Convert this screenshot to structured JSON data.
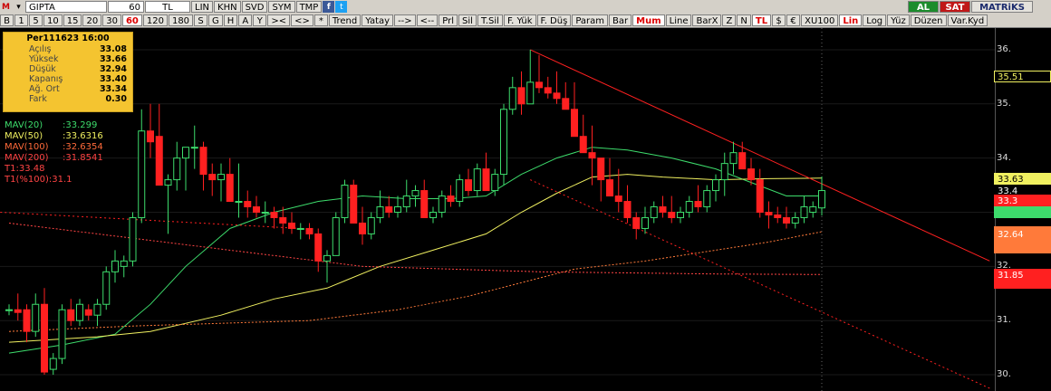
{
  "toolbar": {
    "symbol": "GIPTA",
    "interval_value": "60",
    "currency": "TL",
    "row1_buttons": [
      "LIN",
      "KHN",
      "SVD",
      "SYM",
      "TMP"
    ],
    "right_buttons": {
      "al": "AL",
      "sat": "SAT",
      "brand": "MATRiKS"
    },
    "row2_left": [
      "B",
      "1",
      "5",
      "10",
      "15",
      "20",
      "30",
      "60",
      "120",
      "180",
      "S",
      "G",
      "H",
      "A",
      "Y"
    ],
    "row2_selected": "60",
    "row2_mid": [
      "><",
      "<>",
      "*",
      "Trend",
      "Yatay",
      "-->",
      "<--",
      "Prl",
      "Sil",
      "T.Sil",
      "F. Yük",
      "F. Düş",
      "Param"
    ],
    "row2_type": [
      "Bar",
      "Mum",
      "Line",
      "BarX"
    ],
    "row2_type_selected": "Mum",
    "row2_right": [
      "Z",
      "N",
      "TL",
      "$",
      "€",
      "XU100",
      "Lin",
      "Log",
      "Yüz",
      "Düzen",
      "Var.Kyd"
    ],
    "row2_right_selected": [
      "TL",
      "Lin"
    ]
  },
  "info_box": {
    "header": "Per111623 16:00",
    "rows": [
      {
        "label": "Açılış",
        "value": "33.08"
      },
      {
        "label": "Yüksek",
        "value": "33.66"
      },
      {
        "label": "Düşük",
        "value": "32.94"
      },
      {
        "label": "Kapanış",
        "value": "33.40"
      },
      {
        "label": "Ağ. Ort",
        "value": "33.34"
      },
      {
        "label": "Fark",
        "value": "0.30"
      }
    ]
  },
  "legend": [
    {
      "name": "MAV(20)",
      "value": ":33.299",
      "color": "#3ddc6c"
    },
    {
      "name": "MAV(50)",
      "value": ":33.6316",
      "color": "#f0f060"
    },
    {
      "name": "MAV(100)",
      "value": ":32.6354",
      "color": "#ff6a3a"
    },
    {
      "name": "MAV(200)",
      "value": ":31.8541",
      "color": "#ff4444"
    },
    {
      "name": "T1:33.48",
      "value": "",
      "color": "#ff4444"
    },
    {
      "name": "T1(%100):31.1",
      "value": "",
      "color": "#ff4444"
    }
  ],
  "price_tags": [
    {
      "value": "35.51",
      "bg": "#000000",
      "fg": "#f0f060",
      "border": "#f0f060"
    },
    {
      "value": "33.63",
      "bg": "#f0f060",
      "fg": "#000000",
      "border": "#f0f060"
    },
    {
      "value": "33.4",
      "bg": "#000000",
      "fg": "#ffffff",
      "border": "#000000"
    },
    {
      "value": "33.3",
      "bg": "#ff2020",
      "fg": "#ffffff",
      "border": "#ff2020"
    },
    {
      "value": "",
      "bg": "#3ddc6c",
      "fg": "#000000",
      "border": "#3ddc6c"
    },
    {
      "value": "32.64",
      "bg": "#ff7a3a",
      "fg": "#ffffff",
      "border": "#ff7a3a"
    },
    {
      "value": "31.85",
      "bg": "#ff2020",
      "fg": "#ffffff",
      "border": "#ff2020"
    }
  ],
  "chart_data": {
    "type": "candlestick",
    "y_ticks": [
      "30.",
      "31.",
      "32.",
      "33.",
      "34.",
      "35.",
      "36."
    ],
    "ylim": [
      29.7,
      36.4
    ],
    "up_color": "#3ddc6c",
    "down_color": "#ff2020",
    "candles": [
      [
        31.2,
        31.3,
        31.1,
        31.2
      ],
      [
        31.2,
        31.5,
        31.0,
        31.15
      ],
      [
        31.2,
        31.3,
        30.6,
        30.8
      ],
      [
        30.8,
        31.5,
        30.7,
        31.3
      ],
      [
        31.3,
        31.6,
        30.0,
        30.05
      ],
      [
        30.1,
        30.4,
        30.0,
        30.3
      ],
      [
        30.3,
        31.3,
        30.2,
        31.2
      ],
      [
        31.2,
        31.4,
        30.9,
        31.0
      ],
      [
        31.0,
        31.4,
        30.9,
        31.3
      ],
      [
        31.2,
        31.3,
        31.0,
        31.1
      ],
      [
        31.1,
        31.4,
        30.9,
        31.3
      ],
      [
        31.3,
        32.0,
        31.2,
        31.9
      ],
      [
        31.9,
        32.3,
        31.7,
        32.1
      ],
      [
        32.0,
        32.2,
        31.8,
        32.1
      ],
      [
        32.1,
        33.0,
        32.0,
        32.9
      ],
      [
        32.9,
        34.9,
        32.8,
        34.5
      ],
      [
        34.5,
        35.0,
        34.0,
        34.3
      ],
      [
        34.4,
        35.0,
        33.5,
        33.5
      ],
      [
        33.5,
        33.7,
        32.6,
        33.6
      ],
      [
        33.6,
        34.3,
        33.4,
        34.0
      ],
      [
        34.0,
        34.2,
        33.4,
        34.2
      ],
      [
        34.2,
        34.6,
        33.8,
        34.2
      ],
      [
        34.2,
        34.3,
        33.4,
        33.7
      ],
      [
        33.7,
        33.9,
        33.3,
        33.6
      ],
      [
        33.6,
        33.9,
        33.2,
        33.7
      ],
      [
        33.7,
        34.0,
        33.4,
        33.2
      ],
      [
        33.2,
        33.9,
        32.9,
        33.2
      ],
      [
        33.2,
        33.4,
        32.9,
        33.1
      ],
      [
        33.1,
        33.3,
        32.9,
        33.0
      ],
      [
        33.0,
        33.2,
        32.8,
        33.0
      ],
      [
        33.0,
        33.1,
        32.7,
        32.9
      ],
      [
        32.9,
        33.1,
        32.6,
        32.8
      ],
      [
        32.8,
        33.0,
        32.6,
        32.7
      ],
      [
        32.7,
        32.8,
        32.5,
        32.7
      ],
      [
        32.7,
        32.8,
        32.5,
        32.6
      ],
      [
        32.6,
        32.7,
        31.9,
        32.1
      ],
      [
        32.1,
        32.3,
        31.7,
        32.2
      ],
      [
        32.2,
        33.0,
        32.2,
        32.9
      ],
      [
        32.9,
        33.6,
        32.8,
        33.5
      ],
      [
        33.5,
        33.6,
        32.8,
        32.8
      ],
      [
        32.8,
        33.1,
        32.4,
        32.6
      ],
      [
        32.6,
        33.0,
        32.5,
        32.9
      ],
      [
        32.9,
        33.4,
        32.8,
        33.1
      ],
      [
        33.1,
        33.3,
        32.9,
        33.0
      ],
      [
        33.0,
        33.3,
        32.9,
        33.1
      ],
      [
        33.1,
        33.6,
        33.0,
        33.3
      ],
      [
        33.3,
        33.5,
        33.1,
        33.4
      ],
      [
        33.4,
        33.6,
        33.0,
        32.9
      ],
      [
        32.9,
        33.1,
        32.8,
        33.0
      ],
      [
        33.0,
        33.4,
        32.9,
        33.3
      ],
      [
        33.3,
        33.5,
        33.1,
        33.2
      ],
      [
        33.2,
        33.7,
        33.1,
        33.6
      ],
      [
        33.6,
        33.8,
        33.3,
        33.4
      ],
      [
        33.4,
        33.9,
        33.3,
        33.8
      ],
      [
        33.8,
        34.1,
        33.5,
        33.4
      ],
      [
        33.4,
        33.8,
        33.3,
        33.7
      ],
      [
        33.7,
        35.0,
        33.5,
        34.9
      ],
      [
        34.9,
        35.5,
        34.8,
        35.3
      ],
      [
        35.3,
        35.6,
        34.8,
        35.0
      ],
      [
        35.0,
        36.0,
        35.0,
        35.4
      ],
      [
        35.4,
        35.9,
        35.2,
        35.3
      ],
      [
        35.3,
        35.5,
        35.1,
        35.2
      ],
      [
        35.2,
        35.6,
        35.0,
        35.1
      ],
      [
        35.1,
        35.4,
        34.9,
        34.9
      ],
      [
        34.9,
        35.4,
        34.4,
        34.4
      ],
      [
        34.4,
        34.8,
        34.1,
        34.1
      ],
      [
        34.1,
        34.6,
        33.5,
        34.0
      ],
      [
        34.0,
        34.0,
        33.2,
        33.6
      ],
      [
        33.6,
        34.0,
        33.4,
        33.3
      ],
      [
        33.3,
        33.8,
        33.0,
        33.2
      ],
      [
        33.2,
        33.5,
        32.8,
        32.9
      ],
      [
        32.9,
        33.0,
        32.5,
        32.7
      ],
      [
        32.7,
        33.1,
        32.6,
        32.9
      ],
      [
        32.9,
        33.2,
        32.8,
        33.1
      ],
      [
        33.1,
        33.3,
        32.9,
        33.0
      ],
      [
        33.0,
        33.3,
        32.8,
        32.9
      ],
      [
        32.9,
        33.1,
        32.8,
        33.0
      ],
      [
        33.0,
        33.3,
        32.9,
        33.2
      ],
      [
        33.2,
        33.5,
        33.0,
        33.1
      ],
      [
        33.1,
        33.5,
        33.0,
        33.4
      ],
      [
        33.4,
        33.7,
        33.2,
        33.6
      ],
      [
        33.6,
        34.1,
        33.3,
        33.9
      ],
      [
        33.9,
        34.3,
        33.7,
        34.1
      ],
      [
        34.1,
        34.3,
        33.8,
        33.8
      ],
      [
        33.8,
        34.0,
        33.5,
        33.6
      ],
      [
        33.6,
        33.8,
        32.9,
        33.0
      ],
      [
        33.0,
        33.2,
        32.7,
        32.95
      ],
      [
        32.95,
        33.1,
        32.8,
        32.9
      ],
      [
        32.9,
        33.1,
        32.7,
        32.8
      ],
      [
        32.8,
        33.0,
        32.7,
        32.9
      ],
      [
        32.9,
        33.3,
        32.8,
        33.1
      ],
      [
        33.0,
        33.2,
        32.9,
        33.1
      ],
      [
        33.08,
        33.66,
        32.94,
        33.4
      ]
    ],
    "mav": [
      {
        "name": "MAV(20)",
        "color": "#3ddc6c",
        "dash": false,
        "points": [
          [
            0,
            30.4
          ],
          [
            6,
            30.55
          ],
          [
            12,
            30.75
          ],
          [
            16,
            31.3
          ],
          [
            20,
            32.0
          ],
          [
            25,
            32.7
          ],
          [
            30,
            33.0
          ],
          [
            35,
            33.2
          ],
          [
            40,
            33.3
          ],
          [
            45,
            33.25
          ],
          [
            50,
            33.25
          ],
          [
            54,
            33.3
          ],
          [
            58,
            33.7
          ],
          [
            62,
            34.0
          ],
          [
            66,
            34.2
          ],
          [
            70,
            34.15
          ],
          [
            75,
            34.0
          ],
          [
            80,
            33.8
          ],
          [
            84,
            33.55
          ],
          [
            88,
            33.3
          ],
          [
            92,
            33.3
          ]
        ]
      },
      {
        "name": "MAV(50)",
        "color": "#f0f060",
        "dash": false,
        "points": [
          [
            0,
            30.6
          ],
          [
            10,
            30.7
          ],
          [
            16,
            30.8
          ],
          [
            24,
            31.1
          ],
          [
            30,
            31.4
          ],
          [
            36,
            31.6
          ],
          [
            42,
            32.0
          ],
          [
            48,
            32.3
          ],
          [
            54,
            32.6
          ],
          [
            58,
            33.0
          ],
          [
            62,
            33.35
          ],
          [
            66,
            33.65
          ],
          [
            70,
            33.7
          ],
          [
            74,
            33.65
          ],
          [
            80,
            33.6
          ],
          [
            86,
            33.62
          ],
          [
            92,
            33.63
          ]
        ]
      },
      {
        "name": "MAV(100)",
        "color": "#ff7a3a",
        "dash": true,
        "points": [
          [
            0,
            30.8
          ],
          [
            14,
            30.9
          ],
          [
            24,
            30.95
          ],
          [
            34,
            31.0
          ],
          [
            44,
            31.2
          ],
          [
            52,
            31.45
          ],
          [
            58,
            31.7
          ],
          [
            64,
            31.95
          ],
          [
            72,
            32.1
          ],
          [
            80,
            32.3
          ],
          [
            86,
            32.45
          ],
          [
            92,
            32.64
          ]
        ]
      },
      {
        "name": "MAV(200)",
        "color": "#ff4444",
        "dash": true,
        "points": [
          [
            0,
            32.8
          ],
          [
            10,
            32.6
          ],
          [
            20,
            32.4
          ],
          [
            30,
            32.2
          ],
          [
            40,
            32.0
          ],
          [
            50,
            31.95
          ],
          [
            60,
            31.9
          ],
          [
            70,
            31.88
          ],
          [
            80,
            31.86
          ],
          [
            92,
            31.85
          ]
        ]
      }
    ],
    "trendlines": [
      {
        "name": "T1",
        "color": "#ff2020",
        "dash": false,
        "from": [
          59,
          36.0
        ],
        "to": [
          111,
          32.1
        ]
      },
      {
        "name": "T1(%100)",
        "color": "#ff2020",
        "dash": true,
        "from": [
          59,
          33.6
        ],
        "to": [
          111,
          29.75
        ]
      },
      {
        "name": "T1-left",
        "color": "#ff2020",
        "dash": true,
        "from": [
          -1,
          33.0
        ],
        "to": [
          33,
          32.7
        ]
      }
    ]
  }
}
